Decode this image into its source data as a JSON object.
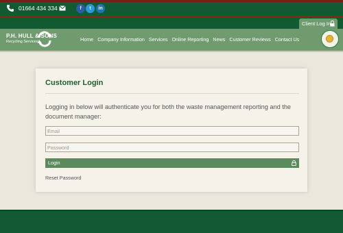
{
  "topbar": {
    "phone": "01664 434 334",
    "social": {
      "facebook": "f",
      "twitter": "t",
      "linkedin": "in"
    }
  },
  "client_login": {
    "label": "Client Log In"
  },
  "logo": {
    "line1": "P.H. HULL & SONS",
    "line2": "Recycling Services"
  },
  "nav": {
    "items": [
      "Home",
      "Company Information",
      "Services",
      "Online Reporting",
      "News",
      "Customer Reviews",
      "Contact Us"
    ]
  },
  "login_card": {
    "title": "Customer Login",
    "description": "Logging in below will authenticate you for both the waste management reporting and the document manager:",
    "email_placeholder": "Email",
    "password_placeholder": "Password",
    "login_label": "Login",
    "reset_label": "Reset Password"
  },
  "colors": {
    "dark_green": "#125a31",
    "nav_green": "#6f9b6f",
    "accent_red": "#8f2219",
    "title_green": "#1f5e2f",
    "button_green": "#5d8a5d"
  },
  "icons": {
    "phone": "phone-icon",
    "mail": "mail-icon",
    "lock": "lock-icon",
    "recycle": "recycle-arrows-icon",
    "badge": "certification-badge-icon"
  }
}
